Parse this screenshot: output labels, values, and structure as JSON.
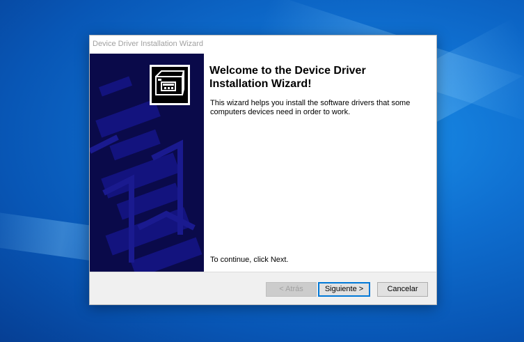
{
  "window": {
    "title": "Device Driver Installation Wizard"
  },
  "wizard": {
    "heading": "Welcome to the Device Driver Installation Wizard!",
    "description": "This wizard helps you install the software drivers that some computers devices need in order to work.",
    "continue_text": "To continue, click Next."
  },
  "buttons": {
    "back_label": "< Atrás",
    "next_label": "Siguiente >",
    "cancel_label": "Cancelar"
  },
  "colors": {
    "sidepanel": "#0a0a4a",
    "desktop": "#0f6fd0",
    "focus_border": "#0078d7"
  },
  "icons": {
    "wizard_logo": "driver-install-icon"
  }
}
